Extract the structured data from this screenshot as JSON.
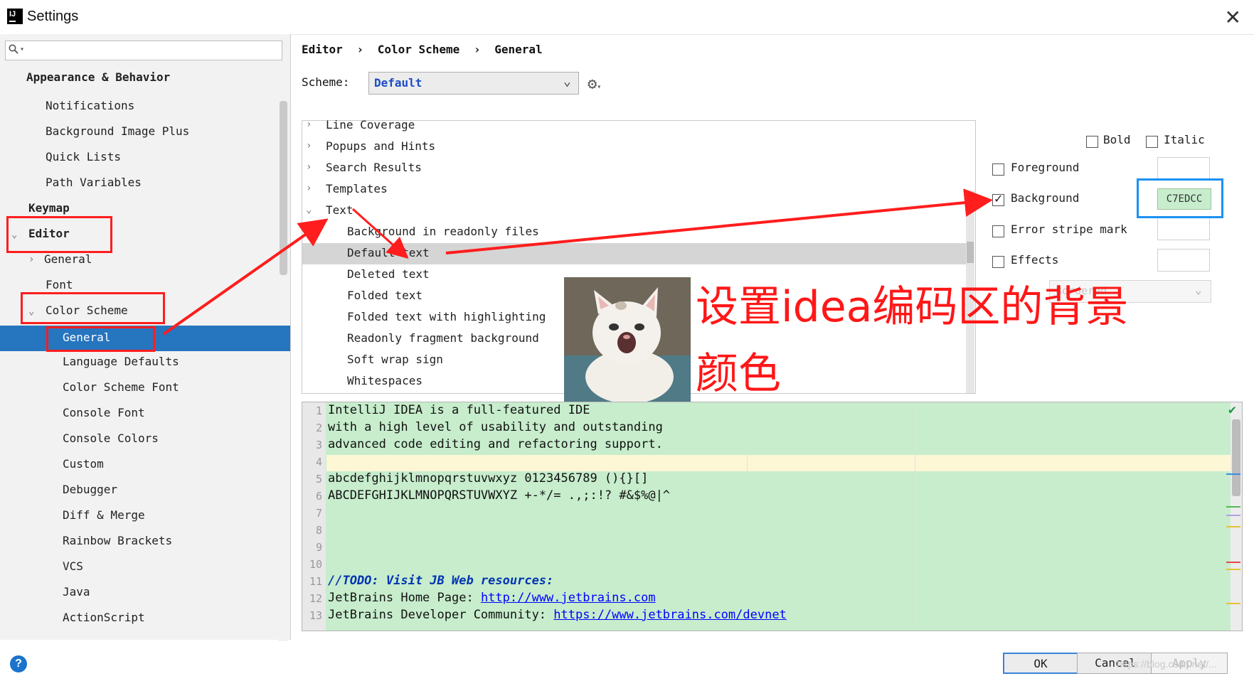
{
  "window": {
    "title": "Settings",
    "close_glyph": "✕"
  },
  "search": {
    "placeholder": ""
  },
  "sidebar": {
    "items": [
      {
        "label": "Appearance & Behavior"
      },
      {
        "label": "Notifications"
      },
      {
        "label": "Background Image Plus"
      },
      {
        "label": "Quick Lists"
      },
      {
        "label": "Path Variables"
      },
      {
        "label": "Keymap"
      },
      {
        "label": "Editor"
      },
      {
        "label": "General"
      },
      {
        "label": "Font"
      },
      {
        "label": "Color Scheme"
      },
      {
        "label": "General"
      },
      {
        "label": "Language Defaults"
      },
      {
        "label": "Color Scheme Font"
      },
      {
        "label": "Console Font"
      },
      {
        "label": "Console Colors"
      },
      {
        "label": "Custom"
      },
      {
        "label": "Debugger"
      },
      {
        "label": "Diff & Merge"
      },
      {
        "label": "Rainbow Brackets"
      },
      {
        "label": "VCS"
      },
      {
        "label": "Java"
      },
      {
        "label": "ActionScript"
      }
    ]
  },
  "breadcrumb": {
    "part1": "Editor",
    "part2": "Color Scheme",
    "part3": "General",
    "sep": "›"
  },
  "scheme": {
    "label": "Scheme:",
    "value": "Default"
  },
  "attributes": {
    "rows": [
      {
        "label": "Line Coverage"
      },
      {
        "label": "Popups and Hints"
      },
      {
        "label": "Search Results"
      },
      {
        "label": "Templates"
      },
      {
        "label": "Text"
      },
      {
        "label": "Background in readonly files"
      },
      {
        "label": "Default text"
      },
      {
        "label": "Deleted text"
      },
      {
        "label": "Folded text"
      },
      {
        "label": "Folded text with highlighting"
      },
      {
        "label": "Readonly fragment background"
      },
      {
        "label": "Soft wrap sign"
      },
      {
        "label": "Whitespaces"
      }
    ],
    "selected": "Default text"
  },
  "options": {
    "bold": {
      "label": "Bold",
      "checked": false
    },
    "italic": {
      "label": "Italic",
      "checked": false
    },
    "foreground": {
      "label": "Foreground",
      "checked": false
    },
    "background": {
      "label": "Background",
      "checked": true,
      "color": "C7EDCC",
      "hex": "#c7edcc"
    },
    "error_stripe": {
      "label": "Error stripe mark",
      "checked": false
    },
    "effects": {
      "label": "Effects",
      "checked": false,
      "value": "Bordered"
    }
  },
  "preview": {
    "lines": [
      {
        "n": "1",
        "text": "IntelliJ IDEA is a full-featured IDE"
      },
      {
        "n": "2",
        "text": "with a high level of usability and outstanding"
      },
      {
        "n": "3",
        "text": "advanced code editing and refactoring support."
      },
      {
        "n": "4",
        "text": ""
      },
      {
        "n": "5",
        "text": "abcdefghijklmnopqrstuvwxyz 0123456789 (){}[]"
      },
      {
        "n": "6",
        "text": "ABCDEFGHIJKLMNOPQRSTUVWXYZ +-*/= .,;:!? #&$%@|^"
      },
      {
        "n": "7",
        "text": ""
      },
      {
        "n": "8",
        "text": ""
      },
      {
        "n": "9",
        "text": ""
      },
      {
        "n": "10",
        "text": ""
      },
      {
        "n": "11",
        "text": "//TODO: Visit JB Web resources:"
      },
      {
        "n": "12",
        "text": "JetBrains Home Page: ",
        "link": "http://www.jetbrains.com"
      },
      {
        "n": "13",
        "text": "JetBrains Developer Community: ",
        "link": "https://www.jetbrains.com/devnet"
      }
    ]
  },
  "buttons": {
    "ok": "OK",
    "cancel": "Cancel",
    "apply": "Apply",
    "help": "?"
  },
  "annotation": {
    "text": "设置idea编码区的背景颜色"
  },
  "watermark": "https://blog.csdn.net/..."
}
